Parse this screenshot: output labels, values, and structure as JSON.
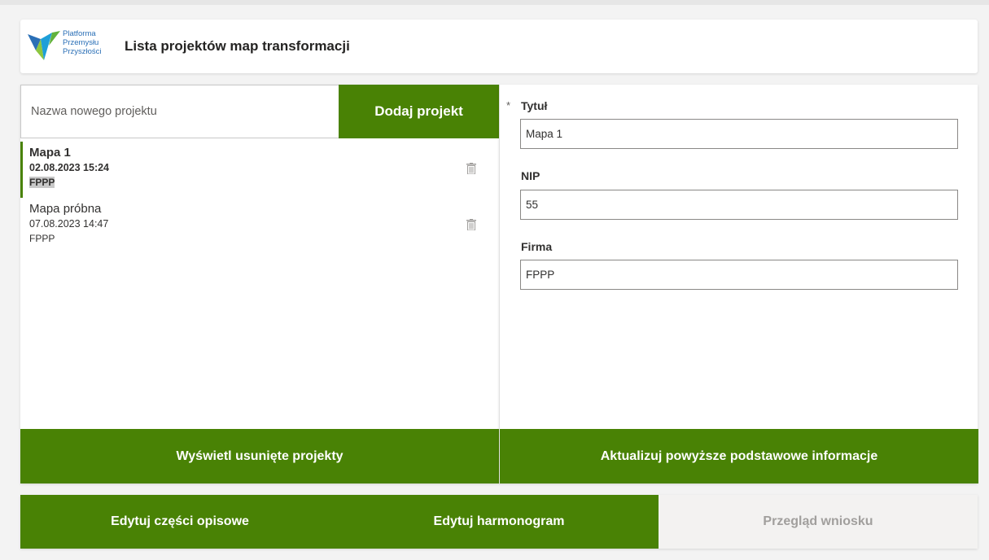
{
  "header": {
    "logo_lines": [
      "Platforma",
      "Przemysłu",
      "Przyszłości"
    ],
    "title": "Lista projektów map transformacji"
  },
  "left": {
    "new_project_placeholder": "Nazwa nowego projektu",
    "add_button": "Dodaj projekt",
    "projects": [
      {
        "name": "Mapa 1",
        "date": "02.08.2023 15:24",
        "company": "FPPP",
        "selected": true
      },
      {
        "name": "Mapa próbna",
        "date": "07.08.2023 14:47",
        "company": "FPPP",
        "selected": false
      }
    ],
    "show_deleted_button": "Wyświetl usunięte projekty"
  },
  "right": {
    "required_mark": "*",
    "fields": [
      {
        "label": "Tytuł",
        "value": "Mapa 1"
      },
      {
        "label": "NIP",
        "value": "55"
      },
      {
        "label": "Firma",
        "value": "FPPP"
      }
    ],
    "update_button": "Aktualizuj powyższe podstawowe informacje"
  },
  "bottom": {
    "buttons": [
      {
        "label": "Edytuj części opisowe",
        "enabled": true
      },
      {
        "label": "Edytuj harmonogram",
        "enabled": true
      },
      {
        "label": "Przegląd wniosku",
        "enabled": false
      }
    ]
  },
  "colors": {
    "accent": "#498205",
    "logo_blue": "#2a6fb6"
  }
}
